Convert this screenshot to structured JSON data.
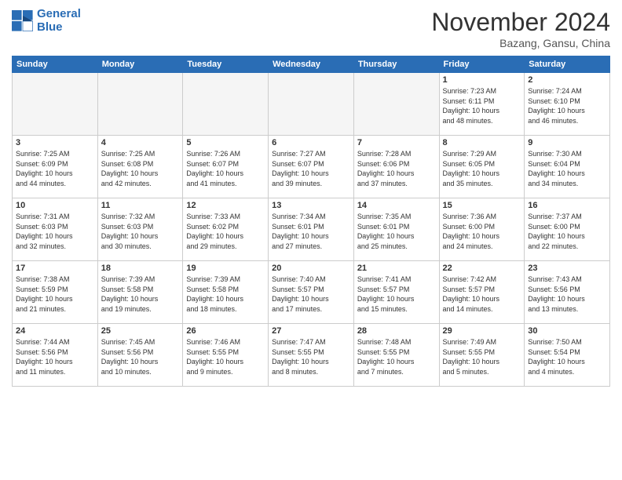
{
  "logo": {
    "line1": "General",
    "line2": "Blue"
  },
  "title": "November 2024",
  "subtitle": "Bazang, Gansu, China",
  "days_of_week": [
    "Sunday",
    "Monday",
    "Tuesday",
    "Wednesday",
    "Thursday",
    "Friday",
    "Saturday"
  ],
  "weeks": [
    [
      {
        "day": "",
        "info": ""
      },
      {
        "day": "",
        "info": ""
      },
      {
        "day": "",
        "info": ""
      },
      {
        "day": "",
        "info": ""
      },
      {
        "day": "",
        "info": ""
      },
      {
        "day": "1",
        "info": "Sunrise: 7:23 AM\nSunset: 6:11 PM\nDaylight: 10 hours\nand 48 minutes."
      },
      {
        "day": "2",
        "info": "Sunrise: 7:24 AM\nSunset: 6:10 PM\nDaylight: 10 hours\nand 46 minutes."
      }
    ],
    [
      {
        "day": "3",
        "info": "Sunrise: 7:25 AM\nSunset: 6:09 PM\nDaylight: 10 hours\nand 44 minutes."
      },
      {
        "day": "4",
        "info": "Sunrise: 7:25 AM\nSunset: 6:08 PM\nDaylight: 10 hours\nand 42 minutes."
      },
      {
        "day": "5",
        "info": "Sunrise: 7:26 AM\nSunset: 6:07 PM\nDaylight: 10 hours\nand 41 minutes."
      },
      {
        "day": "6",
        "info": "Sunrise: 7:27 AM\nSunset: 6:07 PM\nDaylight: 10 hours\nand 39 minutes."
      },
      {
        "day": "7",
        "info": "Sunrise: 7:28 AM\nSunset: 6:06 PM\nDaylight: 10 hours\nand 37 minutes."
      },
      {
        "day": "8",
        "info": "Sunrise: 7:29 AM\nSunset: 6:05 PM\nDaylight: 10 hours\nand 35 minutes."
      },
      {
        "day": "9",
        "info": "Sunrise: 7:30 AM\nSunset: 6:04 PM\nDaylight: 10 hours\nand 34 minutes."
      }
    ],
    [
      {
        "day": "10",
        "info": "Sunrise: 7:31 AM\nSunset: 6:03 PM\nDaylight: 10 hours\nand 32 minutes."
      },
      {
        "day": "11",
        "info": "Sunrise: 7:32 AM\nSunset: 6:03 PM\nDaylight: 10 hours\nand 30 minutes."
      },
      {
        "day": "12",
        "info": "Sunrise: 7:33 AM\nSunset: 6:02 PM\nDaylight: 10 hours\nand 29 minutes."
      },
      {
        "day": "13",
        "info": "Sunrise: 7:34 AM\nSunset: 6:01 PM\nDaylight: 10 hours\nand 27 minutes."
      },
      {
        "day": "14",
        "info": "Sunrise: 7:35 AM\nSunset: 6:01 PM\nDaylight: 10 hours\nand 25 minutes."
      },
      {
        "day": "15",
        "info": "Sunrise: 7:36 AM\nSunset: 6:00 PM\nDaylight: 10 hours\nand 24 minutes."
      },
      {
        "day": "16",
        "info": "Sunrise: 7:37 AM\nSunset: 6:00 PM\nDaylight: 10 hours\nand 22 minutes."
      }
    ],
    [
      {
        "day": "17",
        "info": "Sunrise: 7:38 AM\nSunset: 5:59 PM\nDaylight: 10 hours\nand 21 minutes."
      },
      {
        "day": "18",
        "info": "Sunrise: 7:39 AM\nSunset: 5:58 PM\nDaylight: 10 hours\nand 19 minutes."
      },
      {
        "day": "19",
        "info": "Sunrise: 7:39 AM\nSunset: 5:58 PM\nDaylight: 10 hours\nand 18 minutes."
      },
      {
        "day": "20",
        "info": "Sunrise: 7:40 AM\nSunset: 5:57 PM\nDaylight: 10 hours\nand 17 minutes."
      },
      {
        "day": "21",
        "info": "Sunrise: 7:41 AM\nSunset: 5:57 PM\nDaylight: 10 hours\nand 15 minutes."
      },
      {
        "day": "22",
        "info": "Sunrise: 7:42 AM\nSunset: 5:57 PM\nDaylight: 10 hours\nand 14 minutes."
      },
      {
        "day": "23",
        "info": "Sunrise: 7:43 AM\nSunset: 5:56 PM\nDaylight: 10 hours\nand 13 minutes."
      }
    ],
    [
      {
        "day": "24",
        "info": "Sunrise: 7:44 AM\nSunset: 5:56 PM\nDaylight: 10 hours\nand 11 minutes."
      },
      {
        "day": "25",
        "info": "Sunrise: 7:45 AM\nSunset: 5:56 PM\nDaylight: 10 hours\nand 10 minutes."
      },
      {
        "day": "26",
        "info": "Sunrise: 7:46 AM\nSunset: 5:55 PM\nDaylight: 10 hours\nand 9 minutes."
      },
      {
        "day": "27",
        "info": "Sunrise: 7:47 AM\nSunset: 5:55 PM\nDaylight: 10 hours\nand 8 minutes."
      },
      {
        "day": "28",
        "info": "Sunrise: 7:48 AM\nSunset: 5:55 PM\nDaylight: 10 hours\nand 7 minutes."
      },
      {
        "day": "29",
        "info": "Sunrise: 7:49 AM\nSunset: 5:55 PM\nDaylight: 10 hours\nand 5 minutes."
      },
      {
        "day": "30",
        "info": "Sunrise: 7:50 AM\nSunset: 5:54 PM\nDaylight: 10 hours\nand 4 minutes."
      }
    ]
  ]
}
